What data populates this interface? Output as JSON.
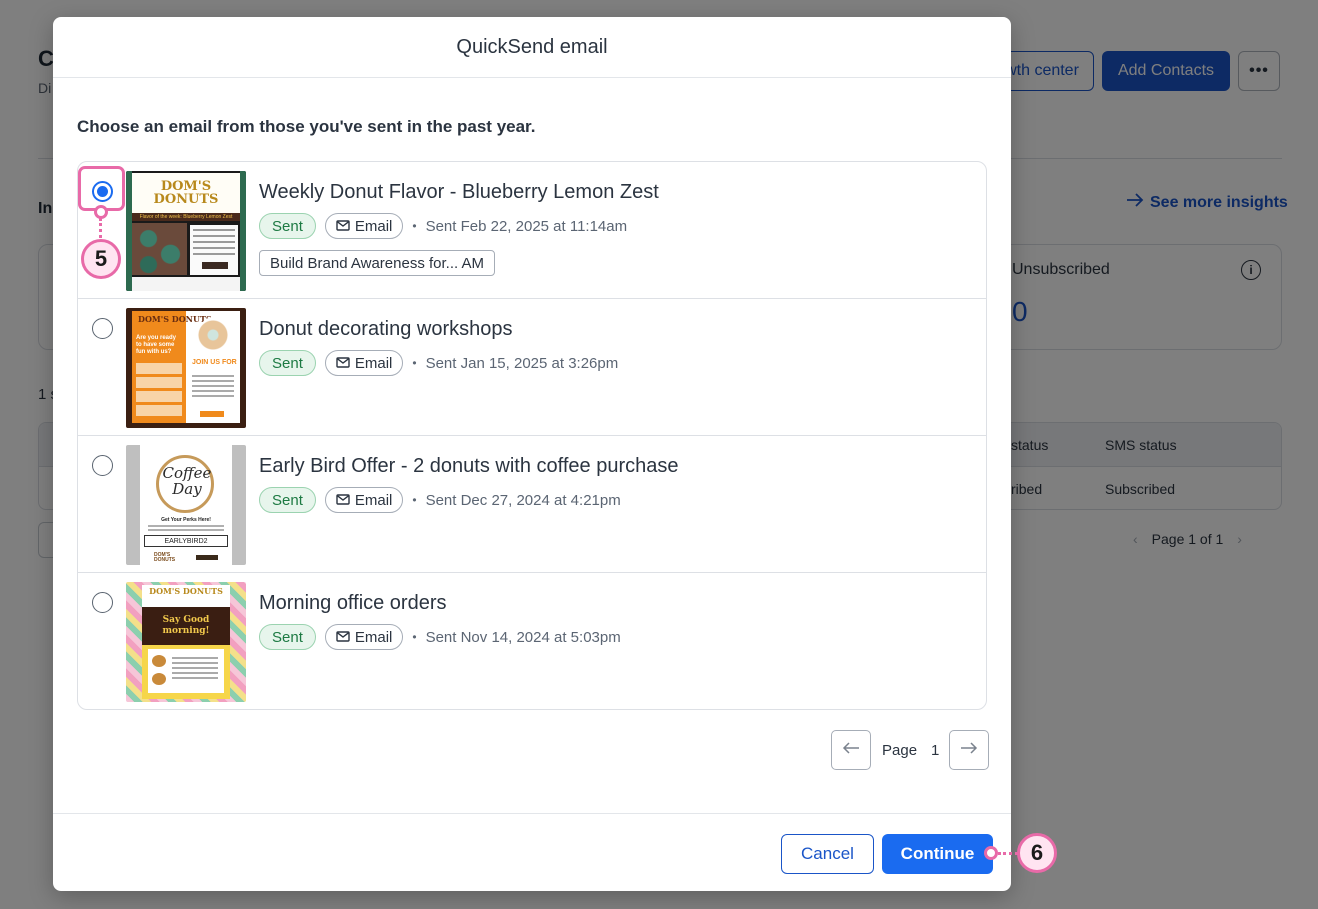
{
  "background": {
    "page_title": "C",
    "page_subtitle": "Di",
    "growth_button": "wth center",
    "add_contacts_button": "Add Contacts",
    "more_button": "•••",
    "insights_heading": "In",
    "see_more_insights": "See more insights",
    "unsubscribed_label": "Unsubscribed",
    "unsubscribed_value": "0",
    "count_label": "1 s",
    "table": {
      "headers": [
        "status",
        "SMS status"
      ],
      "row": [
        "ribed",
        "Subscribed"
      ]
    },
    "pagination_text": "Page 1 of 1"
  },
  "modal": {
    "title": "QuickSend email",
    "instructions": "Choose an email from those you've sent in the past year.",
    "emails": [
      {
        "title": "Weekly Donut Flavor - Blueberry Lemon Zest",
        "status": "Sent",
        "type": "Email",
        "sent_date": "Sent Feb 22, 2025 at 11:14am",
        "campaign_tag": "Build Brand Awareness for... AM",
        "selected": true,
        "thumbnail": {
          "logo": "DOM'S DONUTS",
          "banner": "Flavor of the week: Blueberry Lemon Zest"
        }
      },
      {
        "title": "Donut decorating workshops",
        "status": "Sent",
        "type": "Email",
        "sent_date": "Sent Jan 15, 2025 at 3:26pm",
        "selected": false,
        "thumbnail": {
          "logo": "DOM'S DONUTS",
          "headline": "Are you ready to have some fun with us?",
          "join": "JOIN US FOR"
        }
      },
      {
        "title": "Early Bird Offer - 2 donuts with coffee purchase",
        "status": "Sent",
        "type": "Email",
        "sent_date": "Sent Dec 27, 2024 at 4:21pm",
        "selected": false,
        "thumbnail": {
          "logo_text": "Coffee Day",
          "perks": "Get Your Perks Here!",
          "code": "EARLYBIRD2",
          "footer_logo": "DOM'S DONUTS"
        }
      },
      {
        "title": "Morning office orders",
        "status": "Sent",
        "type": "Email",
        "sent_date": "Sent Nov 14, 2024 at 5:03pm",
        "selected": false,
        "thumbnail": {
          "logo": "DOM'S DONUTS",
          "headline": "Say Good morning!"
        }
      }
    ],
    "pagination": {
      "label": "Page",
      "current": "1"
    },
    "cancel_label": "Cancel",
    "continue_label": "Continue"
  },
  "callouts": {
    "step_a": "5",
    "step_b": "6"
  },
  "colors": {
    "accent": "#1a6bf0",
    "brand_dark": "#1a55c8",
    "callout": "#e86aa8",
    "sent_badge_bg": "#e7f5ec",
    "sent_badge_text": "#1d7a43"
  }
}
